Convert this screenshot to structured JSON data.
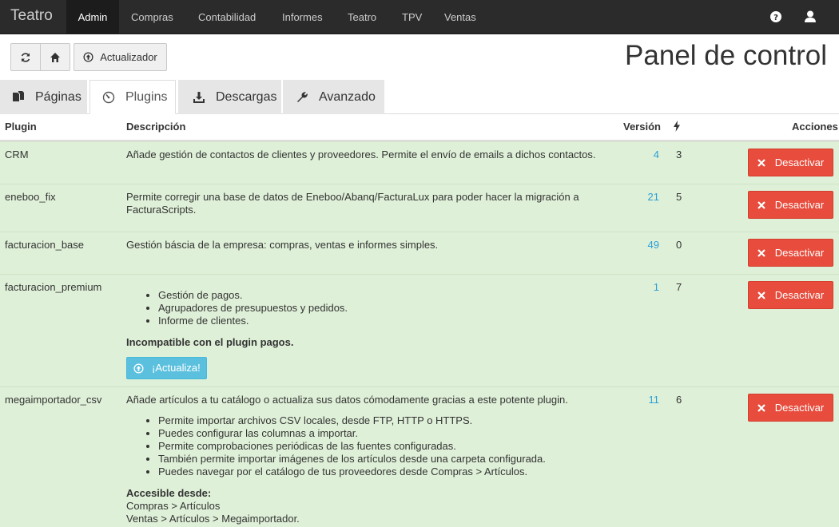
{
  "navbar": {
    "brand": "Teatro",
    "items": [
      {
        "label": "Admin",
        "active": true
      },
      {
        "label": "Compras"
      },
      {
        "label": "Contabilidad"
      },
      {
        "label": "Informes"
      },
      {
        "label": "Teatro"
      },
      {
        "label": "TPV"
      },
      {
        "label": "Ventas"
      }
    ],
    "icons": [
      "help-icon",
      "user-icon"
    ]
  },
  "toolbar": {
    "refresh_icon": "refresh-icon",
    "home_icon": "home-icon",
    "updater_label": "Actualizador"
  },
  "page_title": "Panel de control",
  "tabs": [
    {
      "label": "Páginas",
      "icon": "pages-icon"
    },
    {
      "label": "Plugins",
      "icon": "dashboard-icon",
      "active": true
    },
    {
      "label": "Descargas",
      "icon": "download-icon"
    },
    {
      "label": "Avanzado",
      "icon": "wrench-icon"
    }
  ],
  "table": {
    "headers": {
      "plugin": "Plugin",
      "description": "Descripción",
      "version": "Versión",
      "priority_icon": "bolt-icon",
      "actions": "Acciones"
    },
    "deactivate_label": "Desactivar",
    "rows": [
      {
        "plugin": "CRM",
        "description": "Añade gestión de contactos de clientes y proveedores. Permite el envío de emails a dichos contactos.",
        "version": "4",
        "priority": "3"
      },
      {
        "plugin": "eneboo_fix",
        "description_line1": "Permite corregir una base de datos de Eneboo/Abanq/FacturaLux para poder hacer la migración a",
        "description_line2": "FacturaScripts.",
        "version": "21",
        "priority": "5"
      },
      {
        "plugin": "facturacion_base",
        "description": "Gestión báscia de la empresa: compras, ventas e informes simples.",
        "version": "49",
        "priority": "0"
      },
      {
        "plugin": "facturacion_premium",
        "features": [
          "Gestión de pagos.",
          "Agrupadores de presupuestos y pedidos.",
          "Informe de clientes."
        ],
        "warning": "Incompatible con el plugin pagos.",
        "update_label": "¡Actualiza!",
        "version": "1",
        "priority": "7"
      },
      {
        "plugin": "megaimportador_csv",
        "description": "Añade artículos a tu catálogo o actualiza sus datos cómodamente gracias a este potente plugin.",
        "features": [
          "Permite importar archivos CSV locales, desde FTP, HTTP o HTTPS.",
          "Puedes configurar las columnas a importar.",
          "Permite comprobaciones periódicas de las fuentes configuradas.",
          "También permite importar imágenes de los artículos desde una carpeta configurada.",
          "Puedes navegar por el catálogo de tus proveedores desde Compras > Artículos."
        ],
        "access_title": "Accesible desde:",
        "access_lines": [
          "Compras > Artículos",
          "Ventas > Artículos > Megaimportador."
        ],
        "version": "11",
        "priority": "6"
      }
    ]
  },
  "colors": {
    "navbar": "#2b2b2b",
    "row_success": "#dff0d8",
    "danger": "#e74c3c",
    "info": "#5bc0de",
    "link": "#2a9fd6"
  }
}
